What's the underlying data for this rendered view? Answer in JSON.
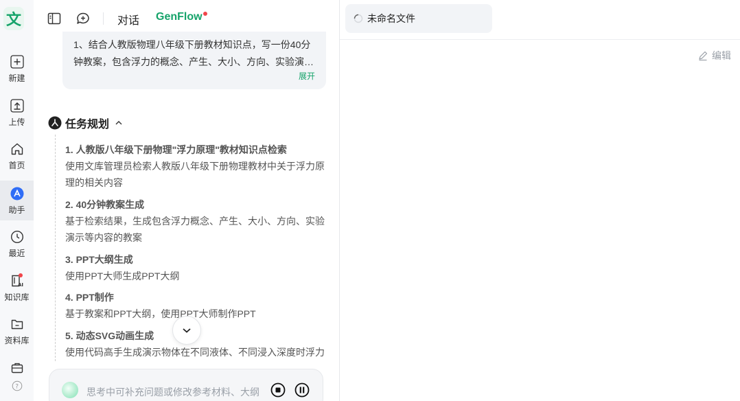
{
  "sidebar": {
    "logo": "文",
    "items": [
      {
        "label": "新建",
        "icon": "plus-icon"
      },
      {
        "label": "上传",
        "icon": "upload-icon"
      },
      {
        "label": "首页",
        "icon": "home-icon"
      },
      {
        "label": "助手",
        "icon": "assistant-icon",
        "active": true
      },
      {
        "label": "最近",
        "icon": "clock-icon"
      },
      {
        "label": "知识库",
        "icon": "knowledge-base-icon",
        "badge": true
      },
      {
        "label": "资料库",
        "icon": "folder-icon"
      }
    ],
    "bottom_icons": [
      "briefcase-icon",
      "help-icon"
    ]
  },
  "header": {
    "tabs": [
      {
        "label": "对话"
      },
      {
        "label": "GenFlow",
        "active": true,
        "badge": true
      }
    ],
    "icons": [
      "sidebar-toggle-icon",
      "new-chat-icon"
    ]
  },
  "message": {
    "lines": [
      "1、结合人教版物理八年级下册教材知识点，写一份40分",
      "钟教案，包含浮力的概念、产生、大小、方向、实验演…"
    ],
    "expand_label": "展开"
  },
  "plan": {
    "title": "任务规划",
    "steps": [
      {
        "heading": "1. 人教版八年级下册物理\"浮力原理\"教材知识点检索",
        "desc": [
          "使用文库管理员检索人教版八年级下册物理教材中关于浮力原",
          "理的相关内容"
        ]
      },
      {
        "heading": "2. 40分钟教案生成",
        "desc": [
          "基于检索结果，生成包含浮力概念、产生、大小、方向、实验",
          "演示等内容的教案"
        ]
      },
      {
        "heading": "3. PPT大纲生成",
        "desc": [
          "使用PPT大师生成PPT大纲"
        ]
      },
      {
        "heading": "4. PPT制作",
        "desc": [
          "基于教案和PPT大纲，使用PPT大师制作PPT"
        ]
      },
      {
        "heading": "5. 动态SVG动画生成",
        "desc": [
          "使用代码高手生成演示物体在不同液体、不同浸入深度时浮力"
        ]
      }
    ]
  },
  "composer": {
    "placeholder": "思考中可补充问题或修改参考材料、大纲"
  },
  "document": {
    "file_name": "未命名文件",
    "edit_label": "编辑"
  },
  "colors": {
    "accent": "#16a36a",
    "badge": "#f0454a",
    "rail_bg": "#f7f8fa",
    "bubble_bg": "#f2f4f7"
  }
}
